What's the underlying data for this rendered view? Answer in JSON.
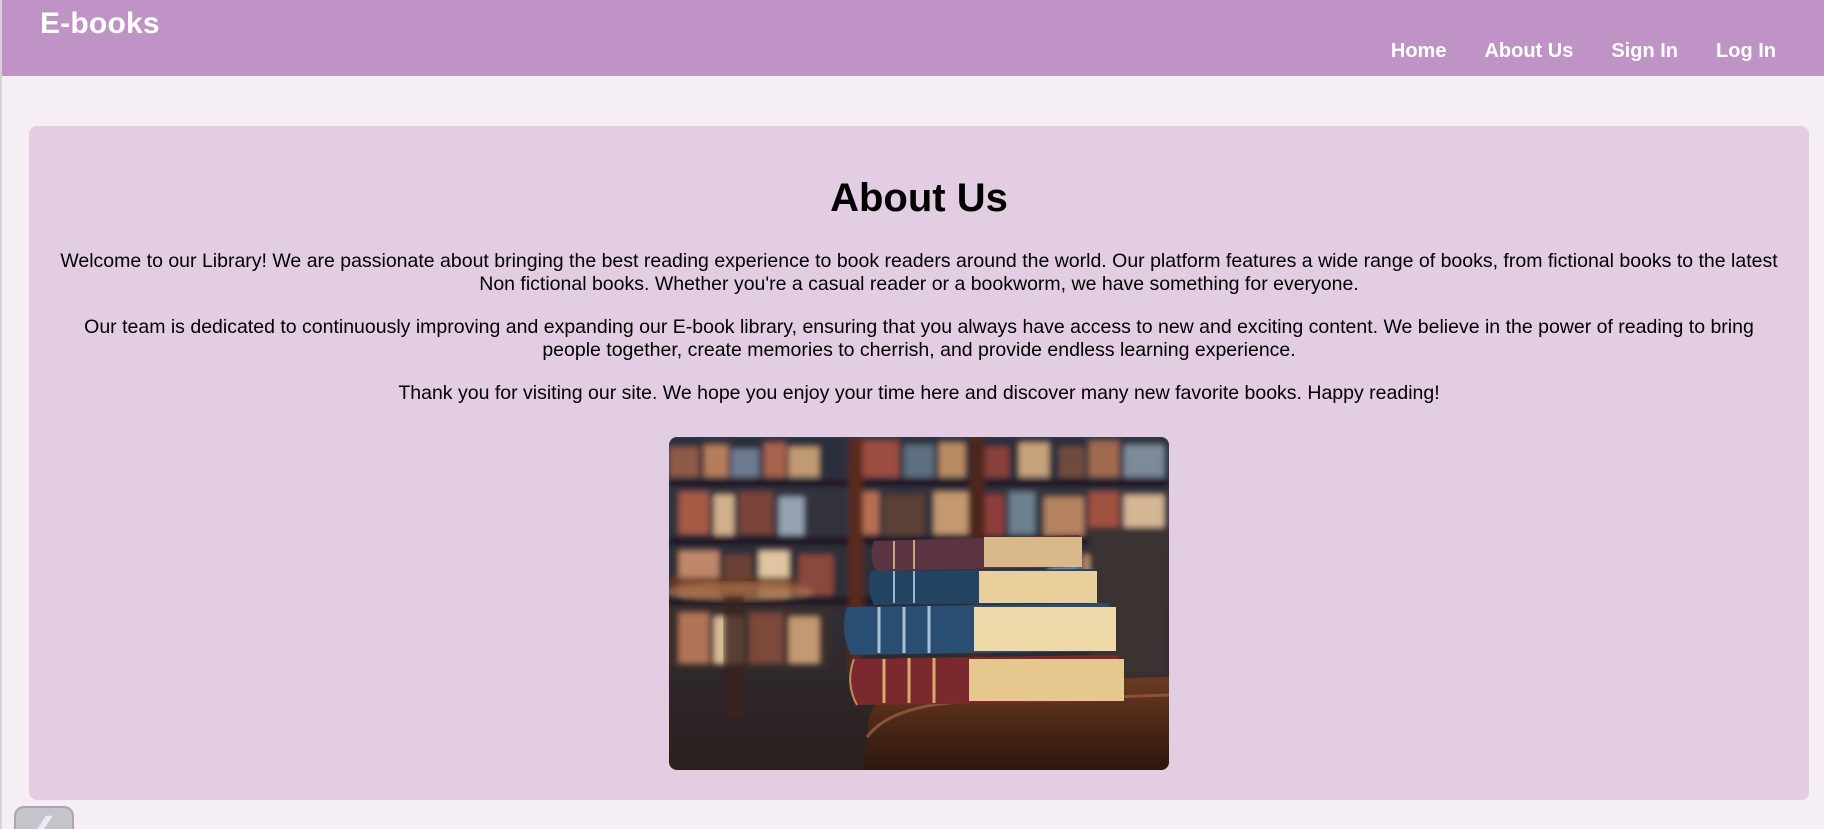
{
  "header": {
    "brand": "E-books",
    "nav": [
      "Home",
      "About Us",
      "Sign In",
      "Log In"
    ]
  },
  "main": {
    "title": "About Us",
    "paragraphs": [
      "Welcome to our Library! We are passionate about bringing the best reading experience to book readers around the world. Our platform features a wide range of books, from fictional books to the latest Non fictional books. Whether you're a casual reader or a bookworm, we have something for everyone.",
      "Our team is dedicated to continuously improving and expanding our E-book library, ensuring that you always have access to new and exciting content. We believe in the power of reading to bring people together, create memories to cherrish, and provide endless learning experience.",
      "Thank you for visiting our site. We hope you enjoy your time here and discover many new favorite books. Happy reading!"
    ],
    "image_icon": "library-books-image"
  },
  "back_button": {
    "icon": "back-arrow-icon",
    "glyph": "❮"
  },
  "colors": {
    "header": "#bf93c5",
    "card": "#e2cde2",
    "page_bg": "#f5eef5"
  }
}
